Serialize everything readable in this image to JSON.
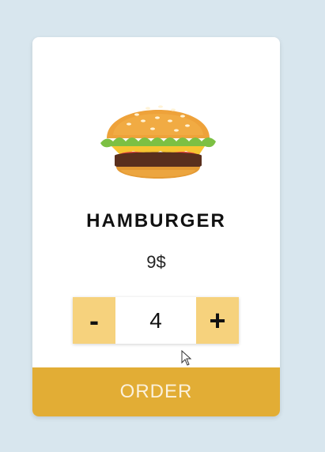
{
  "product": {
    "name": "HAMBURGER",
    "price": "9$",
    "image_icon": "hamburger-image"
  },
  "quantity_stepper": {
    "decrement_label": "-",
    "value": "4",
    "increment_label": "+"
  },
  "order_button": {
    "label": "ORDER"
  },
  "colors": {
    "page_background": "#d8e6ee",
    "card_background": "#ffffff",
    "stepper_button": "#f6d27d",
    "order_button": "#e2ad35",
    "order_text": "#fbf1dc"
  }
}
